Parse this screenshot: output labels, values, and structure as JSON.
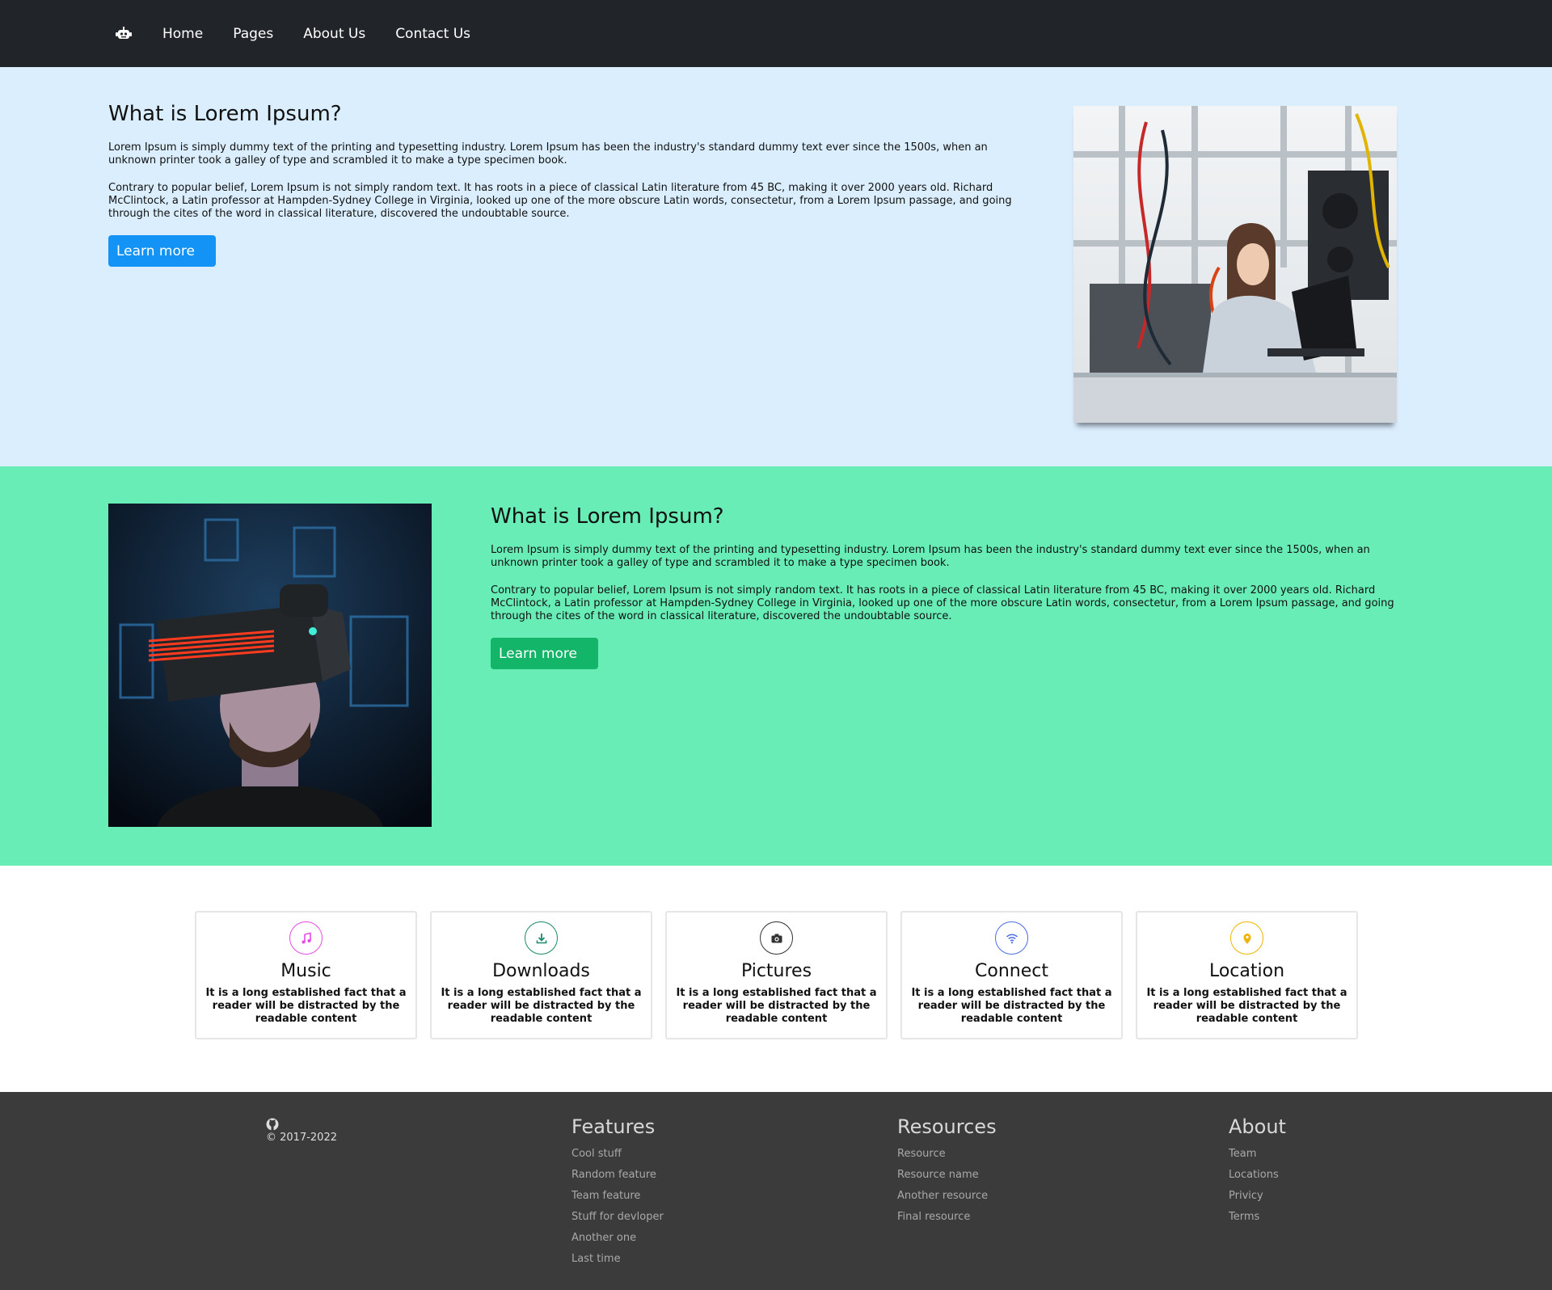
{
  "nav": {
    "logo_icon": "robot-icon",
    "links": [
      "Home",
      "Pages",
      "About Us",
      "Contact Us"
    ]
  },
  "hero1": {
    "title": "What is Lorem Ipsum?",
    "para1": "Lorem Ipsum is simply dummy text of the printing and typesetting industry. Lorem Ipsum has been the industry's standard dummy text ever since the 1500s, when an unknown printer took a galley of type and scrambled it to make a type specimen book.",
    "para2": "Contrary to popular belief, Lorem Ipsum is not simply random text. It has roots in a piece of classical Latin literature from 45 BC, making it over 2000 years old. Richard McClintock, a Latin professor at Hampden-Sydney College in Virginia, looked up one of the more obscure Latin words, consectetur, from a Lorem Ipsum passage, and going through the cites of the word in classical literature, discovered the undoubtable source.",
    "button": "Learn more",
    "button_color": "#1393f5",
    "background": "#dbeefe"
  },
  "hero2": {
    "title": "What is Lorem Ipsum?",
    "para1": "Lorem Ipsum is simply dummy text of the printing and typesetting industry. Lorem Ipsum has been the industry's standard dummy text ever since the 1500s, when an unknown printer took a galley of type and scrambled it to make a type specimen book.",
    "para2": "Contrary to popular belief, Lorem Ipsum is not simply random text. It has roots in a piece of classical Latin literature from 45 BC, making it over 2000 years old. Richard McClintock, a Latin professor at Hampden-Sydney College in Virginia, looked up one of the more obscure Latin words, consectetur, from a Lorem Ipsum passage, and going through the cites of the word in classical literature, discovered the undoubtable source.",
    "button": "Learn more",
    "button_color": "#13b568",
    "background": "#68edb6"
  },
  "features": [
    {
      "title": "Music",
      "icon": "music-icon",
      "color": "#e64be6",
      "text": "It is a long established fact that a reader will be distracted by the readable content"
    },
    {
      "title": "Downloads",
      "icon": "download-icon",
      "color": "#1a8a6a",
      "text": "It is a long established fact that a reader will be distracted by the readable content"
    },
    {
      "title": "Pictures",
      "icon": "camera-icon",
      "color": "#333333",
      "text": "It is a long established fact that a reader will be distracted by the readable content"
    },
    {
      "title": "Connect",
      "icon": "wifi-icon",
      "color": "#4a6fe3",
      "text": "It is a long established fact that a reader will be distracted by the readable content"
    },
    {
      "title": "Location",
      "icon": "location-pin-icon",
      "color": "#f0b400",
      "text": "It is a long established fact that a reader will be distracted by the readable content"
    }
  ],
  "footer": {
    "brand_icon": "github-icon",
    "copyright": "© 2017-2022",
    "columns": [
      {
        "title": "Features",
        "links": [
          "Cool stuff",
          "Random feature",
          "Team feature",
          "Stuff for devloper",
          "Another one",
          "Last time"
        ]
      },
      {
        "title": "Resources",
        "links": [
          "Resource",
          "Resource name",
          "Another resource",
          "Final resource"
        ]
      },
      {
        "title": "About",
        "links": [
          "Team",
          "Locations",
          "Privicy",
          "Terms"
        ]
      }
    ]
  }
}
